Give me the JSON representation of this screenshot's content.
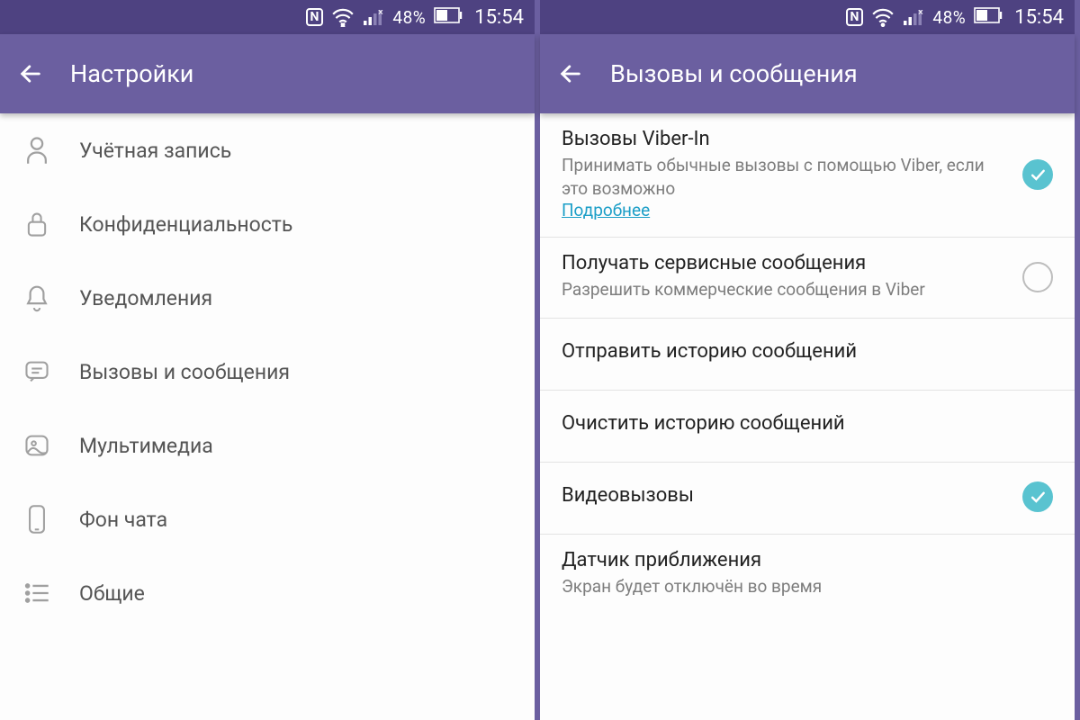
{
  "status": {
    "battery_pct": "48%",
    "clock": "15:54"
  },
  "left": {
    "title": "Настройки",
    "items": [
      {
        "label": "Учётная запись"
      },
      {
        "label": "Конфиденциальность"
      },
      {
        "label": "Уведомления"
      },
      {
        "label": "Вызовы и сообщения"
      },
      {
        "label": "Мультимедиа"
      },
      {
        "label": "Фон чата"
      },
      {
        "label": "Общие"
      }
    ]
  },
  "right": {
    "title": "Вызовы и сообщения",
    "viber_in": {
      "title": "Вызовы Viber-In",
      "subtitle": "Принимать обычные вызовы с помощью Viber, если это возможно",
      "link": "Подробнее"
    },
    "service_msgs": {
      "title": "Получать сервисные сообщения",
      "subtitle": "Разрешить коммерческие сообщения в Viber"
    },
    "send_history": {
      "title": "Отправить историю сообщений"
    },
    "clear_history": {
      "title": "Очистить историю сообщений"
    },
    "video_calls": {
      "title": "Видеовызовы"
    },
    "proximity": {
      "title": "Датчик приближения",
      "subtitle": "Экран будет отключён во время"
    }
  }
}
